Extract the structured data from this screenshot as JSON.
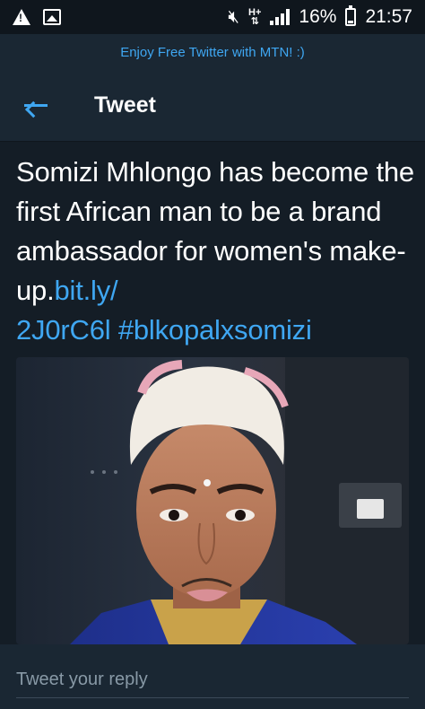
{
  "status_bar": {
    "network_type": "H+",
    "battery_percent": "16%",
    "time": "21:57",
    "icons": [
      "warning-icon",
      "image-icon",
      "mute-icon",
      "network-icon",
      "signal-icon",
      "battery-icon"
    ]
  },
  "banner": {
    "text": "Enjoy Free Twitter with MTN! :)"
  },
  "header": {
    "back_icon": "arrow-left-icon",
    "title": "Tweet"
  },
  "tweet": {
    "text_plain": "Somizi Mhlongo has become the first African man to be a brand ambassador for women's make-up.",
    "link_part1": "bit.ly/",
    "link_part2": "2J0rC6l",
    "hashtag": "#blkopalxsomizi"
  },
  "reply": {
    "placeholder": "Tweet your reply"
  },
  "colors": {
    "background": "#141d26",
    "bar": "#1a2733",
    "accent": "#3fa7f2",
    "muted_text": "#8899a6"
  }
}
